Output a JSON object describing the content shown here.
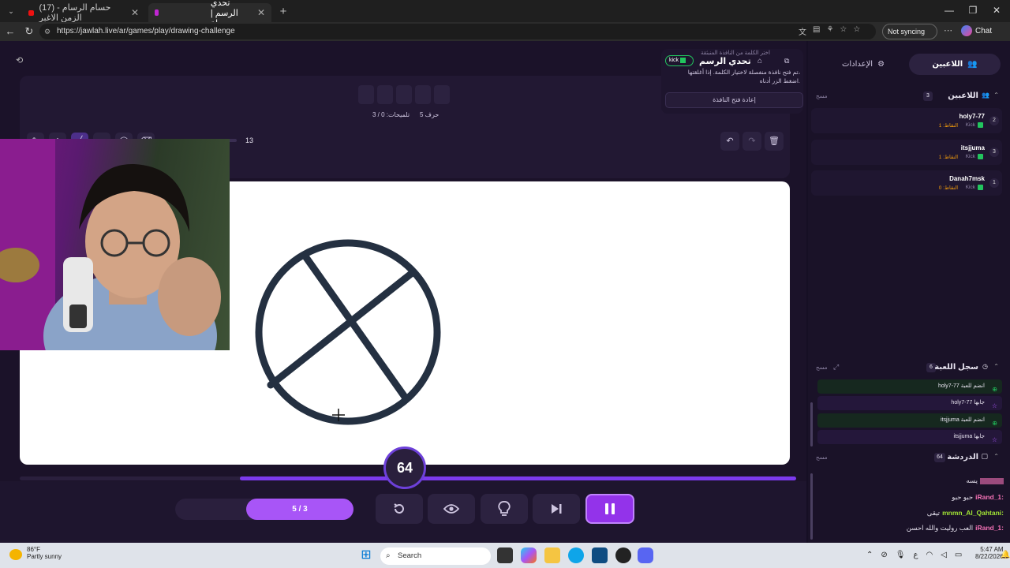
{
  "browser": {
    "tabs": [
      {
        "label": "(17) حسام الرسام - الزمن الاغبر"
      },
      {
        "label": "تحدي الرسم | جولة"
      }
    ],
    "url": "https://jawlah.live/ar/games/play/drawing-challenge",
    "sync_label": "Not syncing",
    "chat_label": "Chat"
  },
  "game": {
    "word_info": "5 حرف",
    "hints_info": "تلميحات: 0 / 3",
    "brush_size": "13",
    "timer": "64",
    "progress_fraction": 0.716,
    "round": "5 / 3"
  },
  "notice": {
    "sub": "اختر الكلمة من النافذة المنبثقة",
    "title": "تحدي الرسم",
    "kick": "kick",
    "body1": "تم فتح نافذة منفصلة لاختيار الكلمة. إذا أغلقتها،",
    "body2": "اضغط الزر أدناه.",
    "reopen": "إعادة فتح النافذة"
  },
  "sidebar": {
    "tab_players": "اللاعبين",
    "tab_settings": "الإعدادات",
    "players_header": "اللاعبين",
    "players_count": "3",
    "clear_label": "مسح",
    "players": [
      {
        "name": "holy7-77",
        "meta": "Kick",
        "score": "النقاط: 1",
        "rank": "2"
      },
      {
        "name": "itsjjuma",
        "meta": "Kick",
        "score": "النقاط: 1",
        "rank": "3"
      },
      {
        "name": "Danah7msk",
        "meta": "Kick",
        "score": "النقاط: 0",
        "rank": "1"
      }
    ],
    "log_header": "سجل اللعبة",
    "log_count": "6",
    "log": [
      {
        "text": "holy7-77 انضم للعبة",
        "type": "join"
      },
      {
        "text": "holy7-77 جابها",
        "type": "ans"
      },
      {
        "text": "itsjjuma انضم للعبة",
        "type": "join"
      },
      {
        "text": "itsjjuma جابها",
        "type": "ans"
      }
    ],
    "chat_header": "الدردشة",
    "chat_count": "64",
    "chat": [
      {
        "user": "",
        "msg": "يسه",
        "color": "#f472b6"
      },
      {
        "user": "iRand_1:",
        "msg": "حبو حبو",
        "color": "#f472b6"
      },
      {
        "user": "mnmn_Al_Qahtani:",
        "msg": "تيقى",
        "color": "#a3e635"
      },
      {
        "user": "iRand_1:",
        "msg": "العب روليت والله احسن",
        "color": "#f472b6"
      }
    ]
  },
  "taskbar": {
    "temp": "86°F",
    "weather": "Partly sunny",
    "search": "Search",
    "time": "5:47 AM",
    "date": "8/22/2026"
  }
}
